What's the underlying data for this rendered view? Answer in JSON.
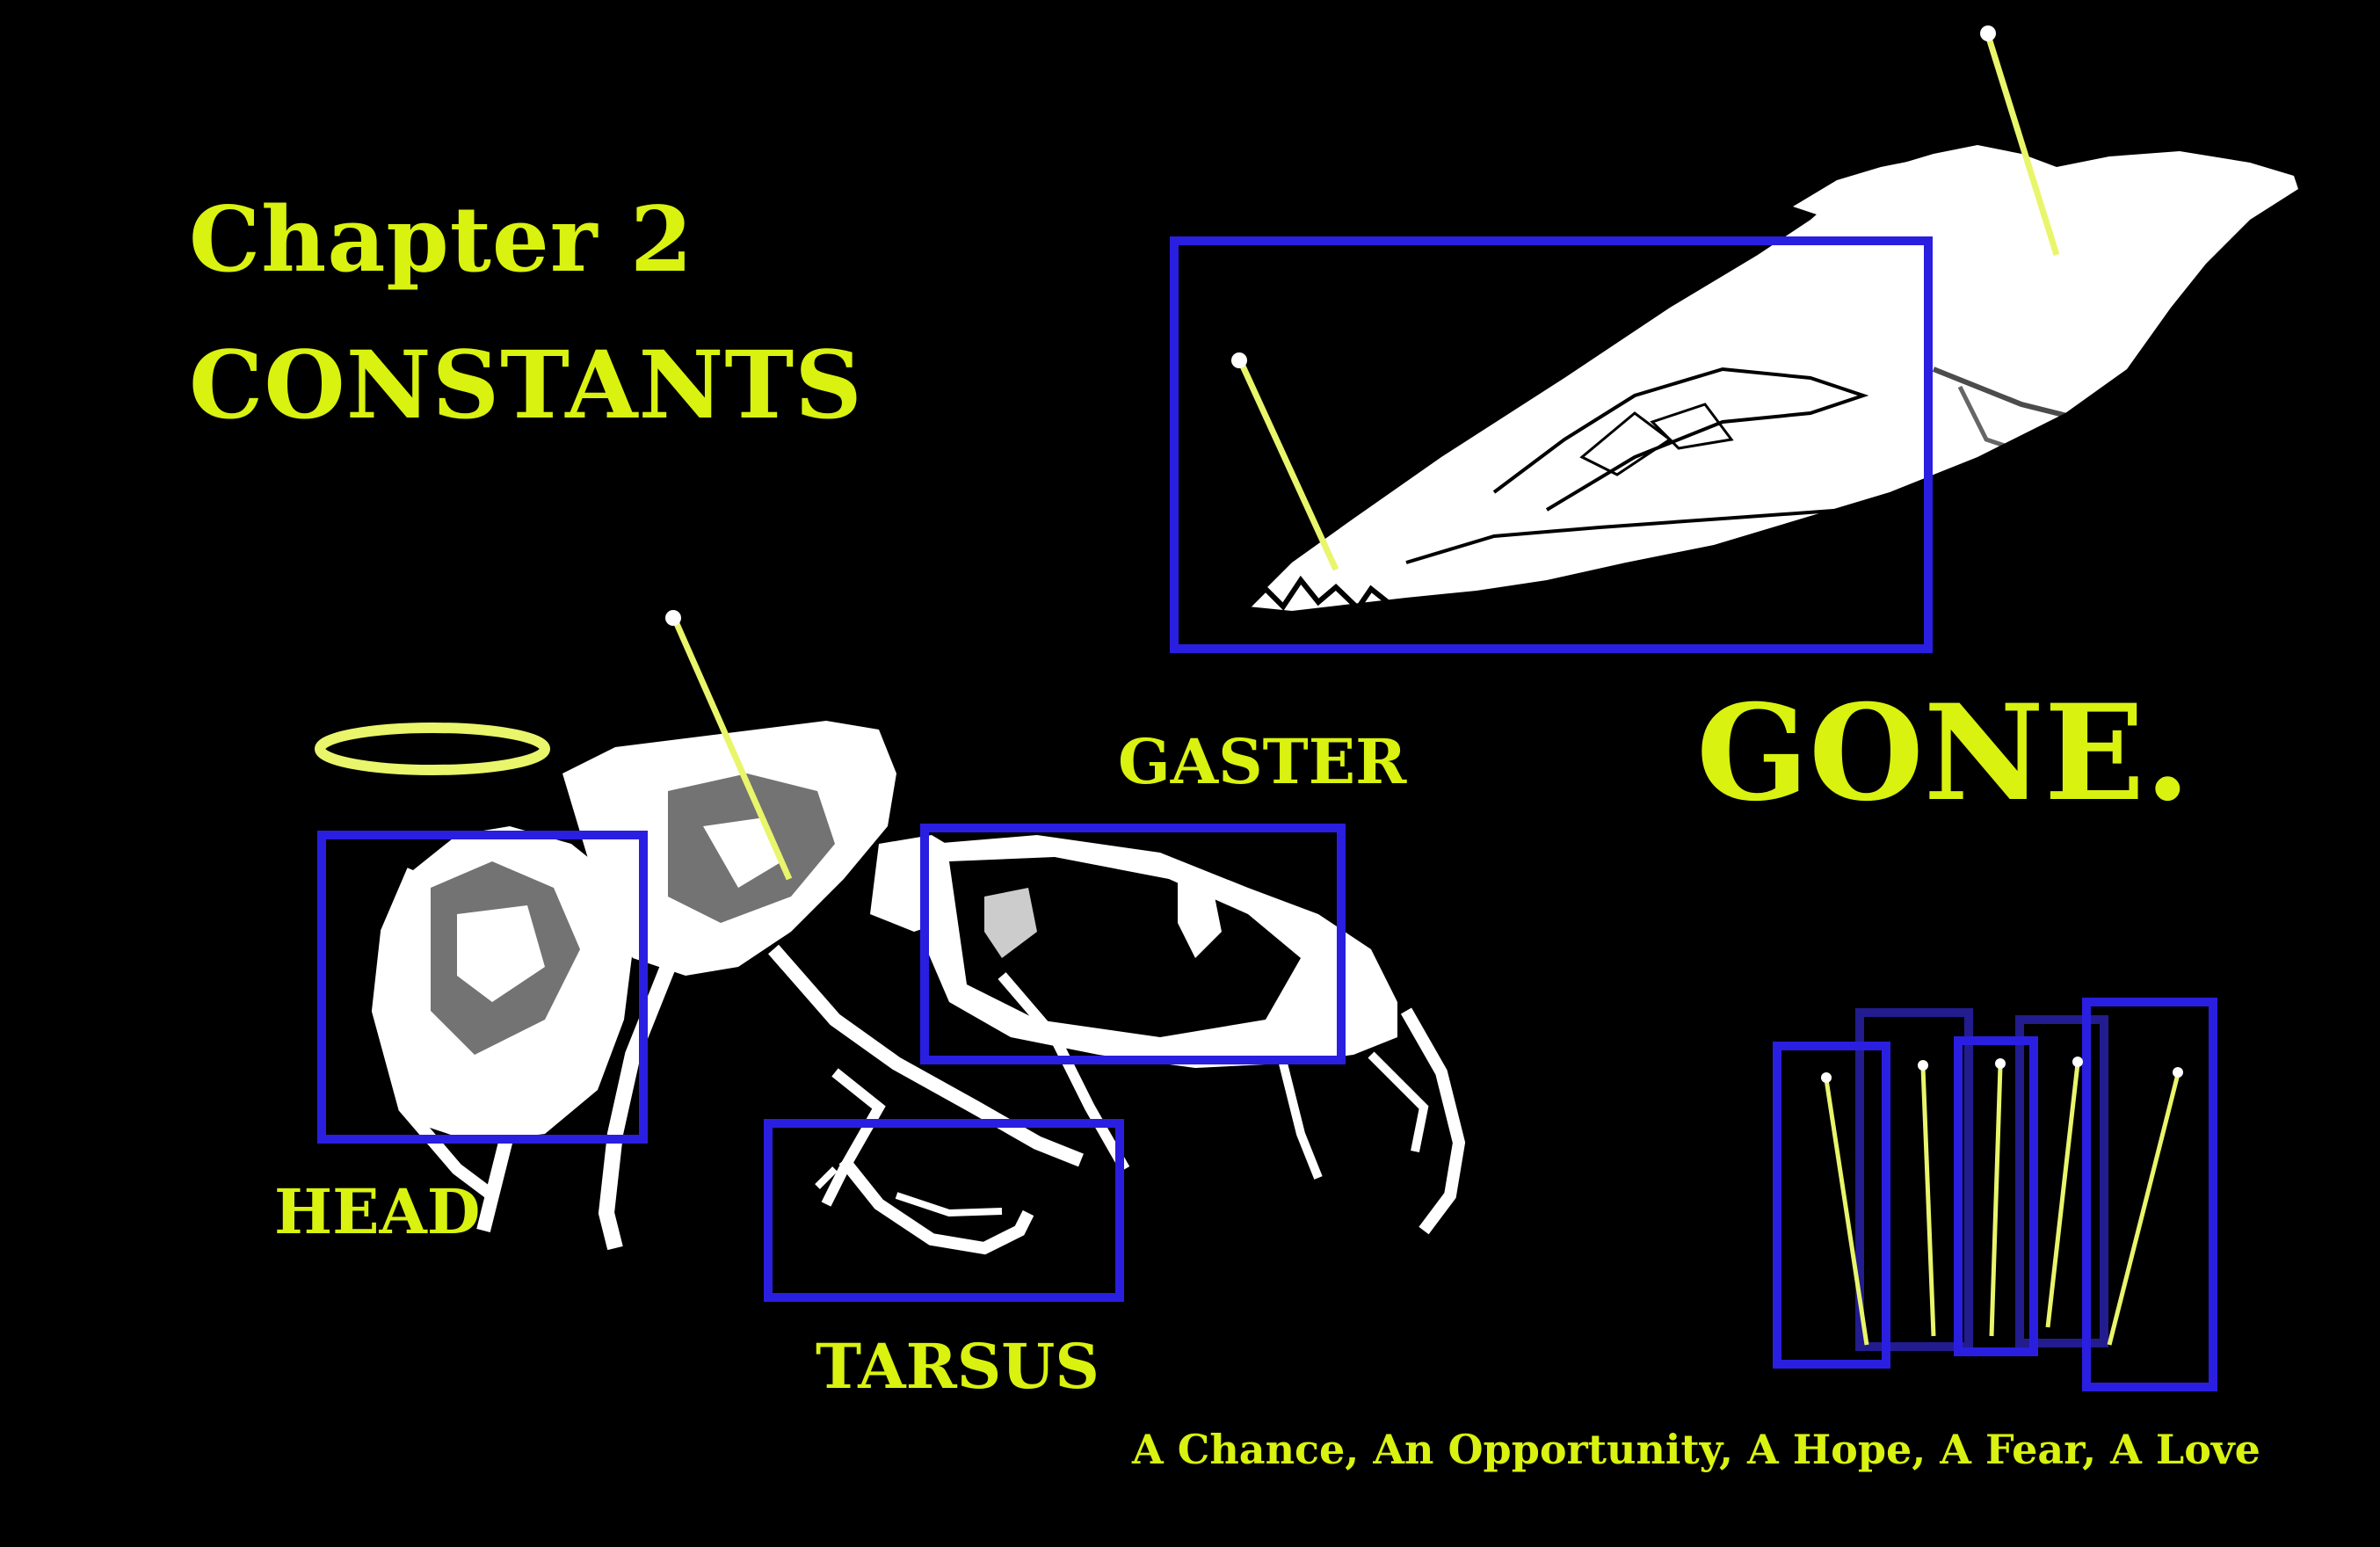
{
  "title": {
    "line1": "Chapter 2",
    "line2": "CONSTANTS"
  },
  "headline": "GONE.",
  "labels": {
    "head": "HEAD",
    "gaster": "GASTER",
    "tarsus": "TARSUS"
  },
  "tagline": "A Chance, An Opportunity, A Hope, A Fear, A Love",
  "colors": {
    "background": "#000000",
    "text": "#d9f20f",
    "box": "#2a1fe0",
    "insect": "#ffffff",
    "pin": "#e9f56a"
  },
  "icons": {
    "halo": "halo-ring",
    "pins": "pin-icon"
  }
}
